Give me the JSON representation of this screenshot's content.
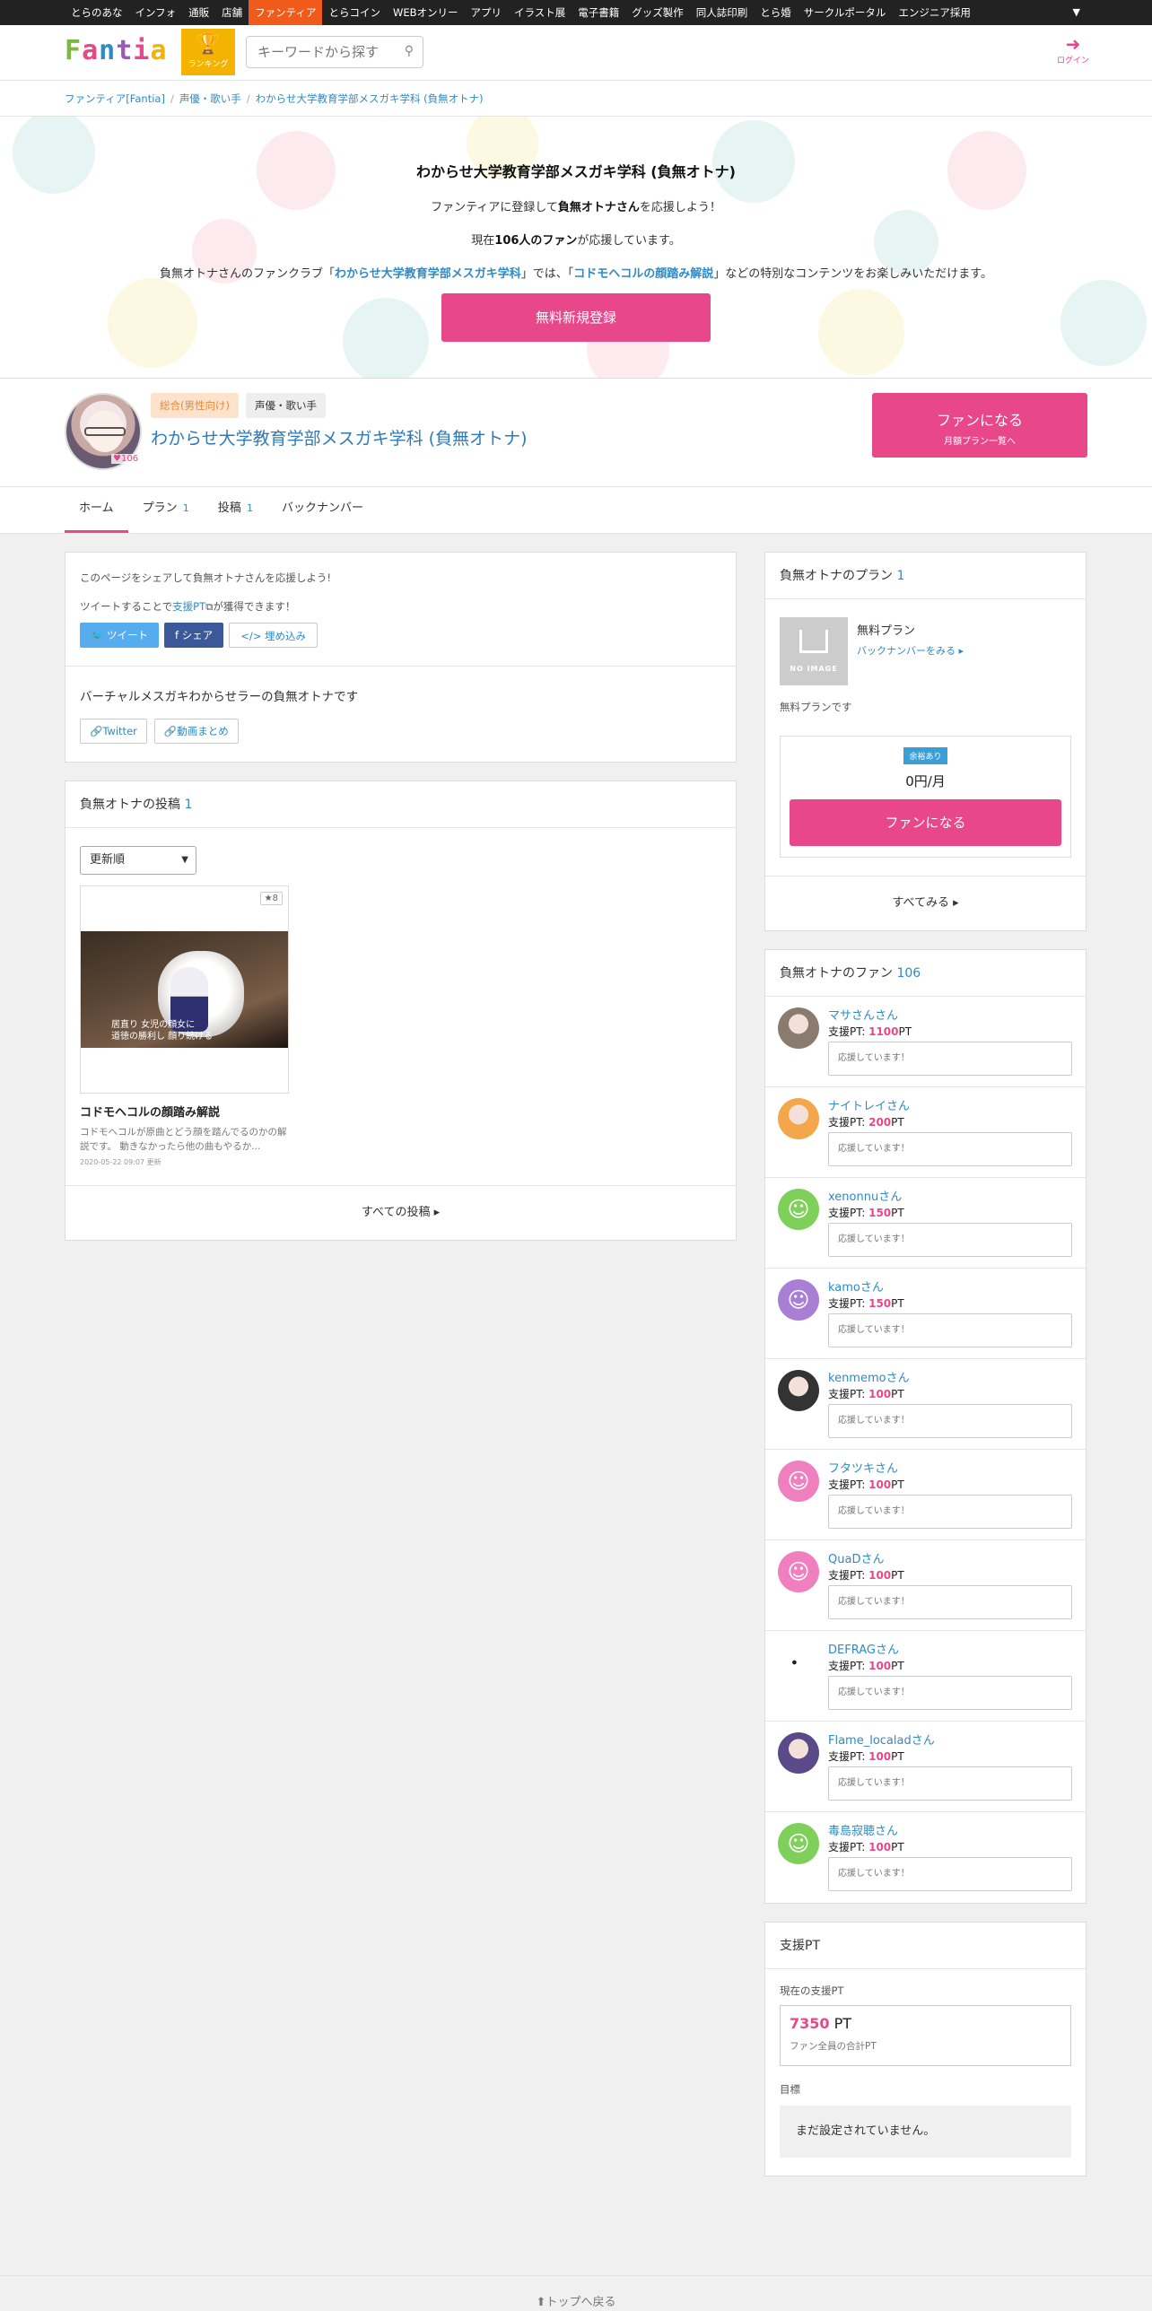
{
  "topnav": {
    "items": [
      "とらのあな",
      "インフォ",
      "通販",
      "店舗",
      "ファンティア",
      "とらコイン",
      "WEBオンリー",
      "アプリ",
      "イラスト展",
      "電子書籍",
      "グッズ製作",
      "同人誌印刷",
      "とら婚",
      "サークルポータル",
      "エンジニア採用"
    ],
    "active": "ファンティア",
    "more_icon": "caret-down-icon"
  },
  "header": {
    "logo_letters": [
      "F",
      "a",
      "n",
      "t",
      "i",
      "a"
    ],
    "logo_colors": [
      "#7ab83f",
      "#e8488a",
      "#2f8ac6",
      "#9b59b6",
      "#e8488a",
      "#f5b301"
    ],
    "ranking_label": "ランキング",
    "search_placeholder": "キーワードから探す",
    "login_label": "ログイン"
  },
  "breadcrumb": [
    "ファンティア[Fantia]",
    "声優・歌い手",
    "わからせ大学教育学部メスガキ学科 (負無オトナ)"
  ],
  "hero": {
    "title": "わからせ大学教育学部メスガキ学科 (負無オトナ)",
    "line1_pre": "ファンティアに登録して",
    "line1_bold": "負無オトナさん",
    "line1_post": "を応援しよう！",
    "line2_pre": "現在",
    "line2_bold": "106人のファン",
    "line2_post": "が応援しています。",
    "line3_pre": "負無オトナさんのファンクラブ「",
    "line3_link1": "わからせ大学教育学部メスガキ学科",
    "line3_mid": "」では、「",
    "line3_link2": "コドモヘコルの顔踏み解説",
    "line3_post": "」などの特別なコンテンツをお楽しみいただけます。",
    "signup_label": "無料新規登録"
  },
  "profile": {
    "fan_count": "106",
    "tags": [
      "総合(男性向け)",
      "声優・歌い手"
    ],
    "name": "わからせ大学教育学部メスガキ学科 (負無オトナ)",
    "fan_button": "ファンになる",
    "fan_button_sub": "月額プラン一覧へ"
  },
  "tabs": [
    {
      "label": "ホーム",
      "count": ""
    },
    {
      "label": "プラン",
      "count": "1"
    },
    {
      "label": "投稿",
      "count": "1"
    },
    {
      "label": "バックナンバー",
      "count": ""
    }
  ],
  "share": {
    "line1": "このページをシェアして負無オトナさんを応援しよう!",
    "line2_pre": "ツイートすることで",
    "line2_link": "支援PT",
    "line2_post": "が獲得できます！",
    "tweet": "ツイート",
    "share": "シェア",
    "embed": "埋め込み"
  },
  "description": {
    "text": "バーチャルメスガキわからせラーの負無オトナです",
    "links": [
      "Twitter",
      "動画まとめ"
    ]
  },
  "posts": {
    "title": "負無オトナの投稿",
    "count": "1",
    "sort": "更新順",
    "items": [
      {
        "likes": "8",
        "caption_line1": "居直り 女児の顔女に",
        "caption_line2": "道徳の勝利し 顔り続ける",
        "title": "コドモヘコルの顔踏み解説",
        "excerpt": "コドモヘコルが原曲とどう顔を踏んでるのかの解説です。 動きなかったら他の曲もやるか...",
        "date": "2020-05-22 09:07 更新"
      }
    ],
    "all_link": "すべての投稿"
  },
  "plans": {
    "title": "負無オトナのプラン",
    "count": "1",
    "noimage": "NO IMAGE",
    "name": "無料プラン",
    "backnumber": "バックナンバーをみる",
    "desc": "無料プランです",
    "availability": "余裕あり",
    "price": "0円/月",
    "join": "ファンになる",
    "see_all": "すべてみる"
  },
  "fans": {
    "title": "負無オトナのファン",
    "count": "106",
    "pt_label": "支援PT: ",
    "pt_suffix": "PT",
    "items": [
      {
        "name": "マサさん󠀠󠀠󠀠󠀠󠀠さん",
        "pt": "1100",
        "msg": "応援しています！",
        "color": "#8a7b6e",
        "type": "photo"
      },
      {
        "name": "ナイトレイさん",
        "pt": "200",
        "msg": "応援しています！",
        "color": "#f4a64a",
        "type": "photo"
      },
      {
        "name": "xenonnuさん",
        "pt": "150",
        "msg": "応援しています！",
        "color": "#7fd05a",
        "type": "smile"
      },
      {
        "name": "kamoさん",
        "pt": "150",
        "msg": "応援しています！",
        "color": "#a97fd6",
        "type": "smile"
      },
      {
        "name": "kenmemoさん",
        "pt": "100",
        "msg": "応援しています！",
        "color": "#333333",
        "type": "photo"
      },
      {
        "name": "フタツキさん",
        "pt": "100",
        "msg": "応援しています！",
        "color": "#ef7fbe",
        "type": "smile"
      },
      {
        "name": "QuaDさん",
        "pt": "100",
        "msg": "応援しています！",
        "color": "#ef7fbe",
        "type": "smile"
      },
      {
        "name": "DEFRAGさん",
        "pt": "100",
        "msg": "応援しています！",
        "color": "#ffffff",
        "type": "photo"
      },
      {
        "name": "Flame_localadさん",
        "pt": "100",
        "msg": "応援しています！",
        "color": "#5a4a8a",
        "type": "photo"
      },
      {
        "name": "毒島寂聴さん",
        "pt": "100",
        "msg": "応援しています！",
        "color": "#7fd05a",
        "type": "smile"
      }
    ]
  },
  "support_pt": {
    "title": "支援PT",
    "current_label": "現在の支援PT",
    "value": "7350",
    "unit": "PT",
    "sub": "ファン全員の合計PT",
    "goal_label": "目標",
    "goal_text": "まだ設定されていません。"
  },
  "footer": {
    "totop": "トップへ戻る"
  }
}
